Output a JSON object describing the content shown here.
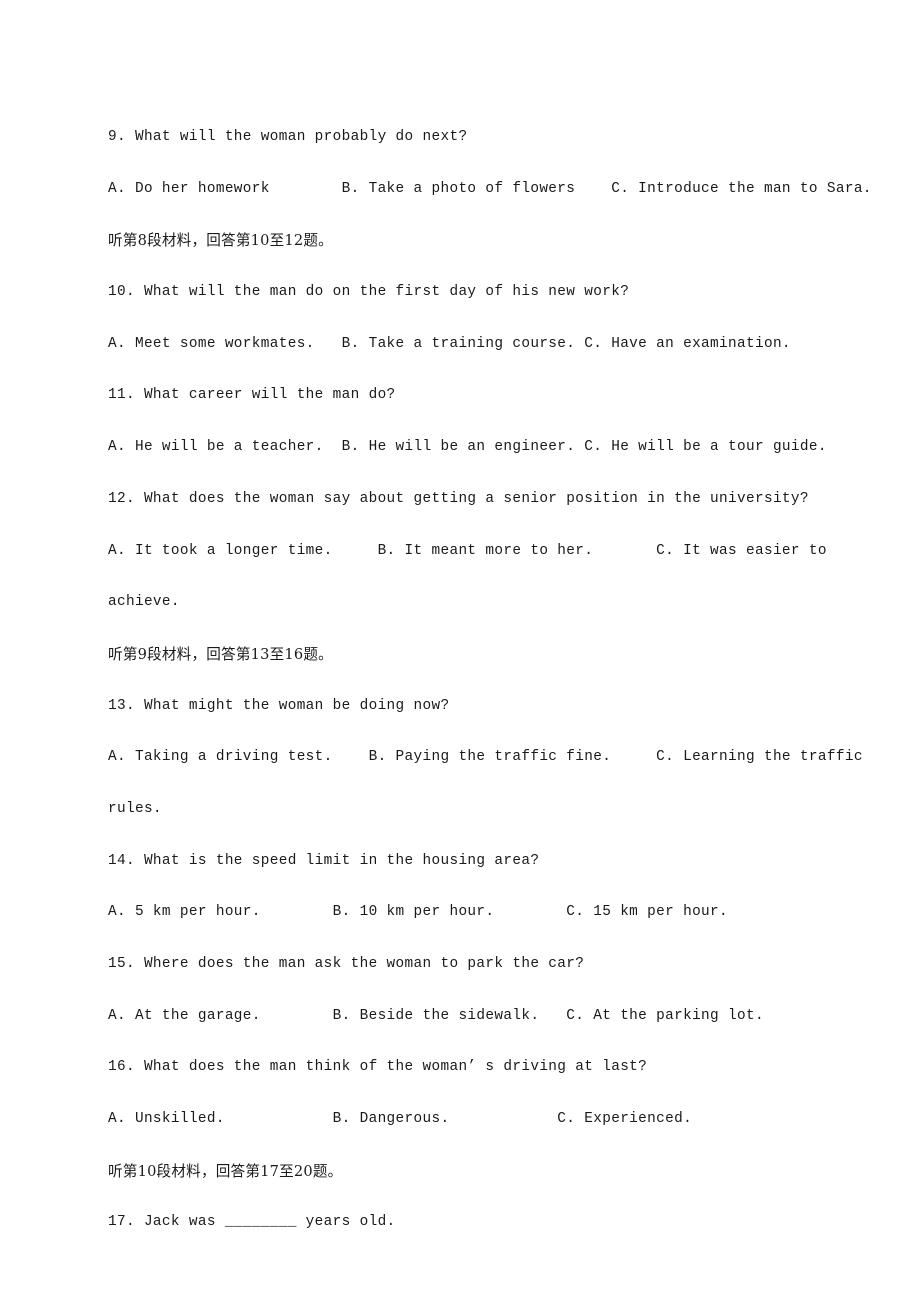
{
  "document": {
    "type": "listening-comprehension-exam",
    "language_mix": [
      "en",
      "zh"
    ],
    "background_color": "#ffffff",
    "text_color": "#1a1a1a"
  },
  "lines": [
    {
      "id": "q9-stem",
      "kind": "question",
      "number": "9.",
      "text": "9. What will the woman probably do next?"
    },
    {
      "id": "q9-options",
      "kind": "options",
      "text": "A. Do her homework        B. Take a photo of flowers    C. Introduce the man to Sara."
    },
    {
      "id": "dir-8",
      "kind": "direction-cjk",
      "text": "听第8段材料，回答第10至12题。"
    },
    {
      "id": "q10-stem",
      "kind": "question",
      "number": "10.",
      "text": "10. What will the man do on the first day of his new work?"
    },
    {
      "id": "q10-options",
      "kind": "options",
      "text": "A. Meet some workmates.   B. Take a training course. C. Have an examination."
    },
    {
      "id": "q11-stem",
      "kind": "question",
      "number": "11.",
      "text": "11. What career will the man do?"
    },
    {
      "id": "q11-options",
      "kind": "options",
      "text": "A. He will be a teacher.  B. He will be an engineer. C. He will be a tour guide."
    },
    {
      "id": "q12-stem",
      "kind": "question",
      "number": "12.",
      "text": "12. What does the woman say about getting a senior position in the university?"
    },
    {
      "id": "q12-options",
      "kind": "options",
      "text": "A. It took a longer time.     B. It meant more to her.       C. It was easier to"
    },
    {
      "id": "q12-options-cont",
      "kind": "options-continuation",
      "text": "achieve."
    },
    {
      "id": "dir-9",
      "kind": "direction-cjk",
      "text": "听第9段材料，回答第13至16题。"
    },
    {
      "id": "q13-stem",
      "kind": "question",
      "number": "13.",
      "text": "13. What might the woman be doing now?"
    },
    {
      "id": "q13-options",
      "kind": "options",
      "text": "A. Taking a driving test.    B. Paying the traffic fine.     C. Learning the traffic"
    },
    {
      "id": "q13-options-cont",
      "kind": "options-continuation",
      "text": "rules."
    },
    {
      "id": "q14-stem",
      "kind": "question",
      "number": "14.",
      "text": "14. What is the speed limit in the housing area?"
    },
    {
      "id": "q14-options",
      "kind": "options",
      "text": "A. 5 km per hour.        B. 10 km per hour.        C. 15 km per hour."
    },
    {
      "id": "q15-stem",
      "kind": "question",
      "number": "15.",
      "text": "15. Where does the man ask the woman to park the car?"
    },
    {
      "id": "q15-options",
      "kind": "options",
      "text": "A. At the garage.        B. Beside the sidewalk.   C. At the parking lot."
    },
    {
      "id": "q16-stem",
      "kind": "question",
      "number": "16.",
      "text": "16. What does the man think of the woman’ s driving at last?"
    },
    {
      "id": "q16-options",
      "kind": "options",
      "text": "A. Unskilled.            B. Dangerous.            C. Experienced."
    },
    {
      "id": "dir-10",
      "kind": "direction-cjk",
      "text": "听第10段材料，回答第17至20题。"
    },
    {
      "id": "q17-stem",
      "kind": "question-with-blank",
      "number": "17.",
      "text": "17. Jack was ________ years old."
    }
  ],
  "questions": [
    {
      "number": "9",
      "stem": "What will the woman probably do next?",
      "options": [
        {
          "label": "A.",
          "text": "Do her homework"
        },
        {
          "label": "B.",
          "text": "Take a photo of flowers"
        },
        {
          "label": "C.",
          "text": "Introduce the man to Sara."
        }
      ]
    },
    {
      "number": "10",
      "stem": "What will the man do on the first day of his new work?",
      "options": [
        {
          "label": "A.",
          "text": "Meet some workmates."
        },
        {
          "label": "B.",
          "text": "Take a training course."
        },
        {
          "label": "C.",
          "text": "Have an examination."
        }
      ]
    },
    {
      "number": "11",
      "stem": "What career will the man do?",
      "options": [
        {
          "label": "A.",
          "text": "He will be a teacher."
        },
        {
          "label": "B.",
          "text": "He will be an engineer."
        },
        {
          "label": "C.",
          "text": "He will be a tour guide."
        }
      ]
    },
    {
      "number": "12",
      "stem": "What does the woman say about getting a senior position in the university?",
      "options": [
        {
          "label": "A.",
          "text": "It took a longer time."
        },
        {
          "label": "B.",
          "text": "It meant more to her."
        },
        {
          "label": "C.",
          "text": "It was easier to achieve."
        }
      ]
    },
    {
      "number": "13",
      "stem": "What might the woman be doing now?",
      "options": [
        {
          "label": "A.",
          "text": "Taking a driving test."
        },
        {
          "label": "B.",
          "text": "Paying the traffic fine."
        },
        {
          "label": "C.",
          "text": "Learning the traffic rules."
        }
      ]
    },
    {
      "number": "14",
      "stem": "What is the speed limit in the housing area?",
      "options": [
        {
          "label": "A.",
          "text": "5 km per hour."
        },
        {
          "label": "B.",
          "text": "10 km per hour."
        },
        {
          "label": "C.",
          "text": "15 km per hour."
        }
      ]
    },
    {
      "number": "15",
      "stem": "Where does the man ask the woman to park the car?",
      "options": [
        {
          "label": "A.",
          "text": "At the garage."
        },
        {
          "label": "B.",
          "text": "Beside the sidewalk."
        },
        {
          "label": "C.",
          "text": "At the parking lot."
        }
      ]
    },
    {
      "number": "16",
      "stem": "What does the man think of the woman’ s driving at last?",
      "options": [
        {
          "label": "A.",
          "text": "Unskilled."
        },
        {
          "label": "B.",
          "text": "Dangerous."
        },
        {
          "label": "C.",
          "text": "Experienced."
        }
      ]
    },
    {
      "number": "17",
      "stem": "Jack was ________ years old.",
      "options": []
    }
  ],
  "directions": [
    {
      "id": "dir-8",
      "text": "听第8段材料，回答第10至12题。",
      "passage": "8",
      "from": "10",
      "to": "12"
    },
    {
      "id": "dir-9",
      "text": "听第9段材料，回答第13至16题。",
      "passage": "9",
      "from": "13",
      "to": "16"
    },
    {
      "id": "dir-10",
      "text": "听第10段材料，回答第17至20题。",
      "passage": "10",
      "from": "17",
      "to": "20"
    }
  ]
}
